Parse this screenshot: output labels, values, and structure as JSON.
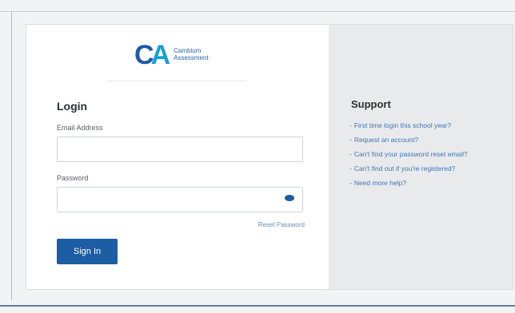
{
  "logo": {
    "mark_c": "C",
    "mark_a": "A",
    "name_line1": "Cambium",
    "name_line2": "Assessment"
  },
  "login": {
    "title": "Login",
    "email_label": "Email Address",
    "email_value": "",
    "password_label": "Password",
    "password_value": "",
    "reset_link": "Reset Password",
    "signin_button": "Sign In"
  },
  "support": {
    "title": "Support",
    "links": [
      "First time login this school year?",
      "Request an account?",
      "Can't find your password reset email?",
      "Can't find out if you're registered?",
      "Need more help?"
    ]
  },
  "icons": {
    "password_toggle": "eye-icon"
  },
  "colors": {
    "brand_blue": "#1d5da3",
    "brand_light_blue": "#19a0d8",
    "link_blue": "#3f78b5",
    "support_bg": "#e9eaec"
  }
}
